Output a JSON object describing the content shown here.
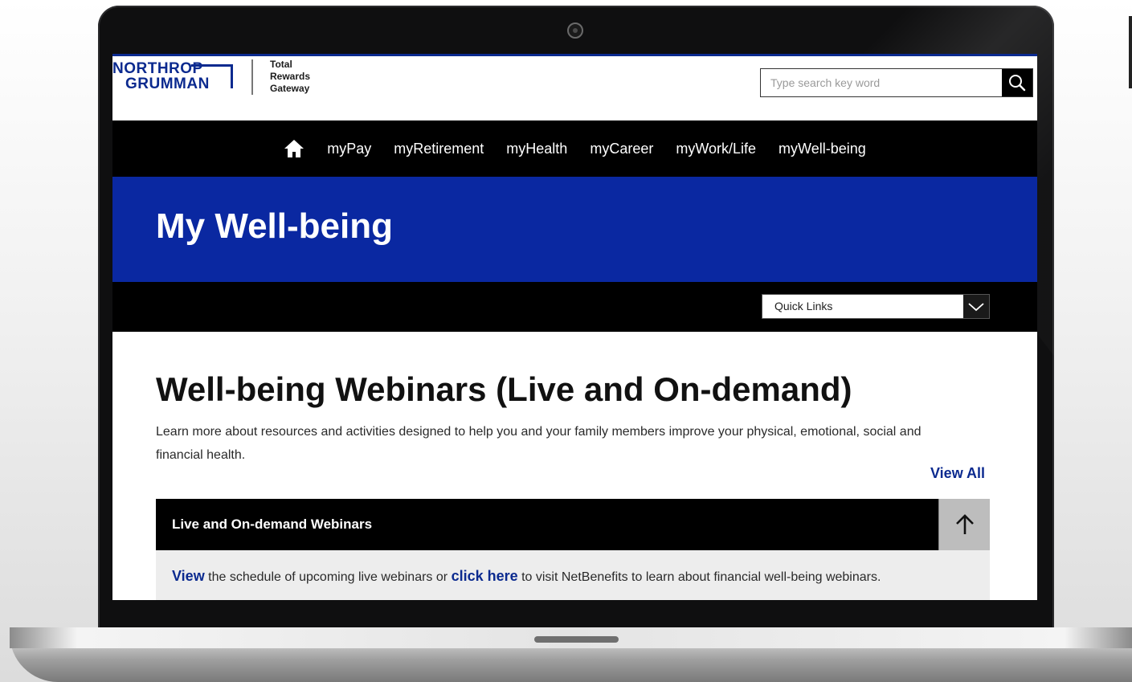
{
  "logo": {
    "line1": "NORTHROP",
    "line2": "GRUMMAN"
  },
  "tagline": {
    "line1": "Total",
    "line2": "Rewards",
    "line3": "Gateway"
  },
  "search": {
    "placeholder": "Type search key word"
  },
  "nav": {
    "items": [
      "myPay",
      "myRetirement",
      "myHealth",
      "myCareer",
      "myWork/Life",
      "myWell-being"
    ]
  },
  "banner": {
    "title": "My Well-being"
  },
  "quick_links": {
    "label": "Quick Links"
  },
  "content": {
    "heading": "Well-being Webinars (Live and On-demand)",
    "description": "Learn more about resources and activities designed to help you and your family members improve your physical, emotional, social and financial health.",
    "view_all": "View All"
  },
  "accordion": {
    "title": "Live and On-demand Webinars",
    "view_link": "View",
    "text1": "the schedule of upcoming live webinars or",
    "click_link": "click here",
    "text2": "to visit NetBenefits to learn about financial well-being webinars."
  },
  "colors": {
    "brand_blue": "#0a28a1",
    "link_blue": "#0b2a8f",
    "nav_bg": "#000000"
  },
  "icons": {
    "home": "home-icon",
    "search": "search-icon",
    "dropdown": "chevron-down-icon",
    "collapse": "arrow-up-icon",
    "camera": "camera-icon"
  }
}
